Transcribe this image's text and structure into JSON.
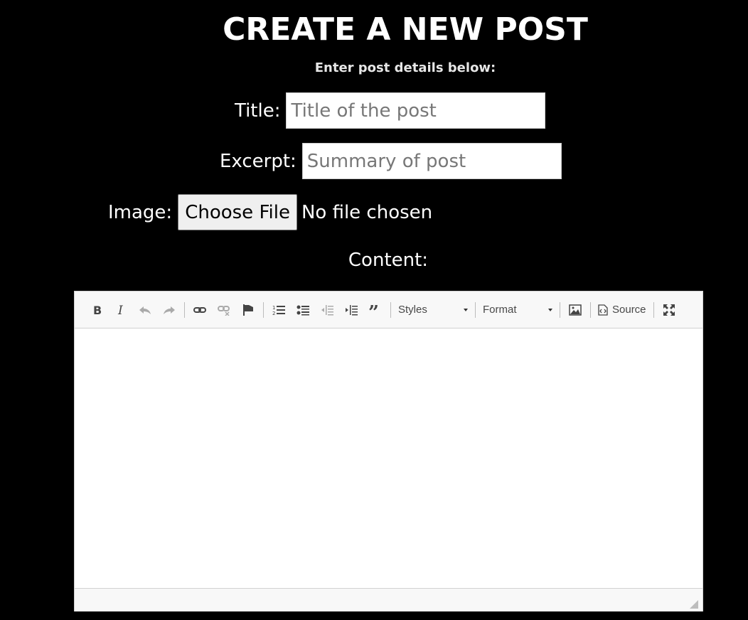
{
  "header": {
    "title": "CREATE A NEW POST",
    "subtitle": "Enter post details below:"
  },
  "form": {
    "title_label": "Title:",
    "title_placeholder": "Title of the post",
    "title_value": "",
    "excerpt_label": "Excerpt:",
    "excerpt_placeholder": "Summary of post",
    "excerpt_value": "",
    "image_label": "Image:",
    "file_button_label": "Choose File",
    "file_status": "No file chosen",
    "content_label": "Content:"
  },
  "editor": {
    "toolbar": {
      "buttons": [
        {
          "icon": "bold-icon",
          "title": "Bold"
        },
        {
          "icon": "italic-icon",
          "title": "Italic"
        },
        {
          "icon": "undo-icon",
          "title": "Undo",
          "disabled": true
        },
        {
          "icon": "redo-icon",
          "title": "Redo",
          "disabled": true
        },
        {
          "icon": "link-icon",
          "title": "Link"
        },
        {
          "icon": "unlink-icon",
          "title": "Unlink",
          "disabled": true
        },
        {
          "icon": "anchor-flag-icon",
          "title": "Anchor"
        },
        {
          "icon": "numbered-list-icon",
          "title": "Numbered List"
        },
        {
          "icon": "bulleted-list-icon",
          "title": "Bulleted List"
        },
        {
          "icon": "outdent-icon",
          "title": "Decrease Indent",
          "disabled": true
        },
        {
          "icon": "indent-icon",
          "title": "Increase Indent"
        },
        {
          "icon": "blockquote-icon",
          "title": "Block Quote"
        },
        {
          "icon": "image-icon",
          "title": "Image"
        },
        {
          "icon": "maximize-icon",
          "title": "Maximize"
        }
      ],
      "styles_label": "Styles",
      "format_label": "Format",
      "source_label": "Source"
    },
    "content": ""
  }
}
